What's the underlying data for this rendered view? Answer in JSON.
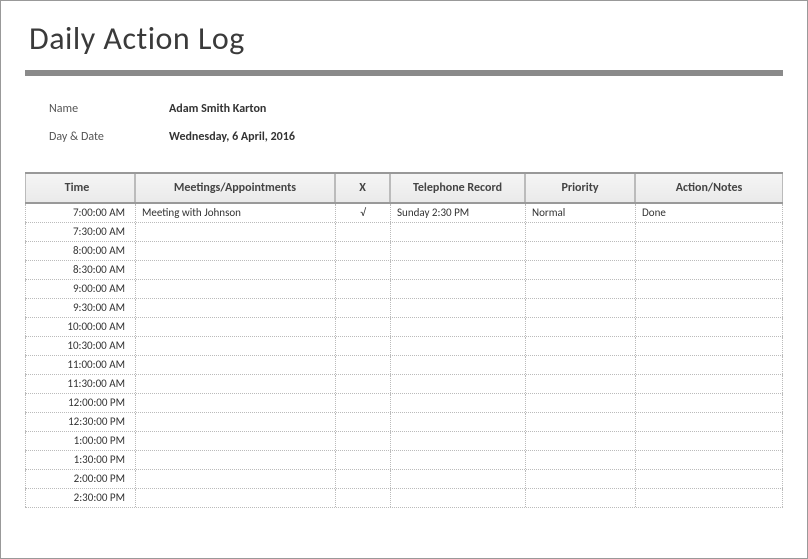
{
  "title": "Daily Action Log",
  "meta": {
    "name_label": "Name",
    "name_value": "Adam Smith Karton",
    "date_label": "Day & Date",
    "date_value": "Wednesday, 6 April, 2016"
  },
  "columns": {
    "time": "Time",
    "meetings": "Meetings/Appointments",
    "x": "X",
    "telephone": "Telephone Record",
    "priority": "Priority",
    "action": "Action/Notes"
  },
  "rows": [
    {
      "time": "7:00:00 AM",
      "meetings": "Meeting with Johnson",
      "x": "√",
      "telephone": "Sunday 2:30 PM",
      "priority": "Normal",
      "action": "Done"
    },
    {
      "time": "7:30:00 AM",
      "meetings": "",
      "x": "",
      "telephone": "",
      "priority": "",
      "action": ""
    },
    {
      "time": "8:00:00 AM",
      "meetings": "",
      "x": "",
      "telephone": "",
      "priority": "",
      "action": ""
    },
    {
      "time": "8:30:00 AM",
      "meetings": "",
      "x": "",
      "telephone": "",
      "priority": "",
      "action": ""
    },
    {
      "time": "9:00:00 AM",
      "meetings": "",
      "x": "",
      "telephone": "",
      "priority": "",
      "action": ""
    },
    {
      "time": "9:30:00 AM",
      "meetings": "",
      "x": "",
      "telephone": "",
      "priority": "",
      "action": ""
    },
    {
      "time": "10:00:00 AM",
      "meetings": "",
      "x": "",
      "telephone": "",
      "priority": "",
      "action": ""
    },
    {
      "time": "10:30:00 AM",
      "meetings": "",
      "x": "",
      "telephone": "",
      "priority": "",
      "action": ""
    },
    {
      "time": "11:00:00 AM",
      "meetings": "",
      "x": "",
      "telephone": "",
      "priority": "",
      "action": ""
    },
    {
      "time": "11:30:00 AM",
      "meetings": "",
      "x": "",
      "telephone": "",
      "priority": "",
      "action": ""
    },
    {
      "time": "12:00:00 PM",
      "meetings": "",
      "x": "",
      "telephone": "",
      "priority": "",
      "action": ""
    },
    {
      "time": "12:30:00 PM",
      "meetings": "",
      "x": "",
      "telephone": "",
      "priority": "",
      "action": ""
    },
    {
      "time": "1:00:00 PM",
      "meetings": "",
      "x": "",
      "telephone": "",
      "priority": "",
      "action": ""
    },
    {
      "time": "1:30:00 PM",
      "meetings": "",
      "x": "",
      "telephone": "",
      "priority": "",
      "action": ""
    },
    {
      "time": "2:00:00 PM",
      "meetings": "",
      "x": "",
      "telephone": "",
      "priority": "",
      "action": ""
    },
    {
      "time": "2:30:00 PM",
      "meetings": "",
      "x": "",
      "telephone": "",
      "priority": "",
      "action": ""
    }
  ]
}
